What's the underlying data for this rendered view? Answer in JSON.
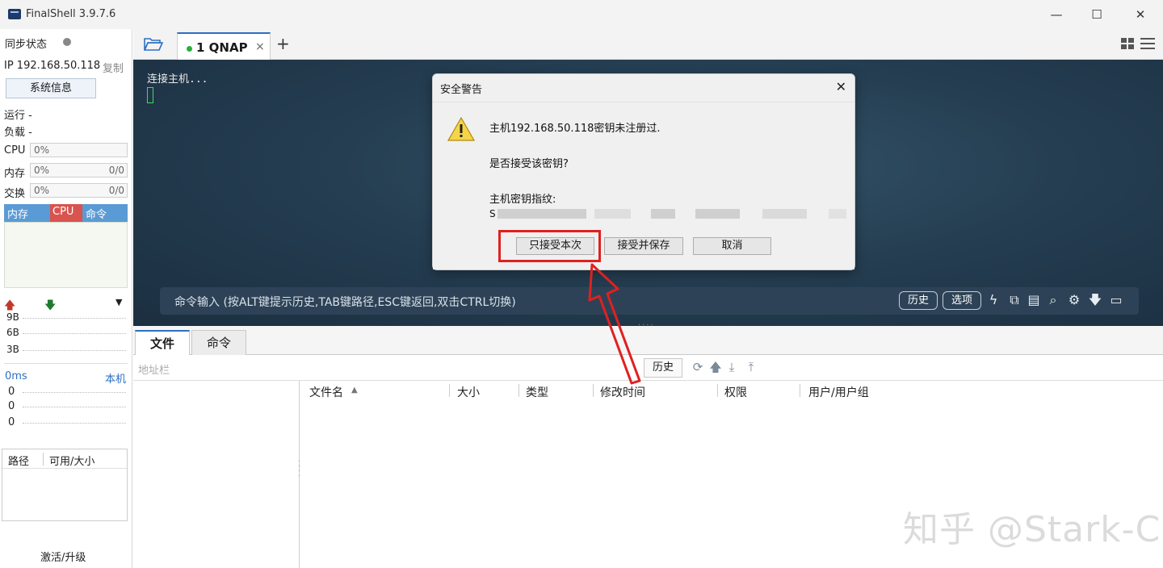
{
  "window": {
    "title": "FinalShell 3.9.7.6",
    "controls": [
      "—",
      "☐",
      "✕"
    ]
  },
  "left_panel": {
    "sync_label": "同步状态",
    "ip_label": "IP 192.168.50.118",
    "copy_label": "复制",
    "sysinfo_button": "系统信息",
    "run_label": "运行 -",
    "load_label": "负载 -",
    "cpu": {
      "label": "CPU",
      "value": "0%"
    },
    "mem": {
      "label": "内存",
      "value": "0%",
      "ratio": "0/0"
    },
    "swap": {
      "label": "交换",
      "value": "0%",
      "ratio": "0/0"
    },
    "tabs": [
      "内存",
      "CPU",
      "命令"
    ],
    "net_scale": [
      "9B",
      "6B",
      "3B"
    ],
    "latency_label": "0ms",
    "local_label": "本机",
    "latency_values": [
      "0",
      "0",
      "0"
    ],
    "disk_headers": [
      "路径",
      "可用/大小"
    ],
    "activate_label": "激活/升级"
  },
  "tabbar": {
    "active_tab": "1 QNAP",
    "tab_close": "×",
    "add_tab": "+"
  },
  "terminal": {
    "output": "连接主机...",
    "command_placeholder": "命令输入 (按ALT键提示历史,TAB键路径,ESC键返回,双击CTRL切换)",
    "history_button": "历史",
    "options_button": "选项"
  },
  "file_panel": {
    "tabs": [
      "文件",
      "命令"
    ],
    "address_placeholder": "地址栏",
    "history_button": "历史",
    "columns": [
      "文件名",
      "大小",
      "类型",
      "修改时间",
      "权限",
      "用户/用户组"
    ],
    "sort_indicator": "▲"
  },
  "dialog": {
    "title": "安全警告",
    "line1": "主机192.168.50.118密钥未注册过.",
    "line2": "是否接受该密钥?",
    "line3": "主机密钥指纹:",
    "fingerprint_prefix": "S",
    "buttons": {
      "accept_once": "只接受本次",
      "accept_save": "接受并保存",
      "cancel": "取消"
    }
  },
  "watermark": "知乎 @Stark-C",
  "colors": {
    "accent": "#2d6fc4",
    "connected": "#27ae3a",
    "highlight": "#e02020",
    "cpu_tab": "#d9534f",
    "mem_tab": "#5b9bd5"
  }
}
